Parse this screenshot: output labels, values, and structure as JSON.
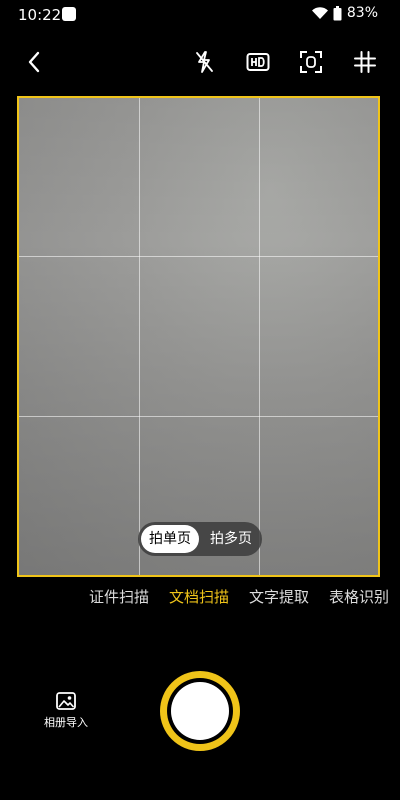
{
  "status_bar": {
    "time": "10:22",
    "battery": "83%"
  },
  "top_bar": {
    "icons": [
      "back-icon",
      "flash-off-icon",
      "hd-icon",
      "focus-icon",
      "grid-icon"
    ]
  },
  "capture_mode": {
    "single_label": "拍单页",
    "multi_label": "拍多页",
    "selected": "拍单页"
  },
  "scan_tabs": [
    {
      "label": "证件扫描",
      "active": false
    },
    {
      "label": "文档扫描",
      "active": true
    },
    {
      "label": "文字提取",
      "active": false
    },
    {
      "label": "表格识别",
      "active": false
    }
  ],
  "bottom": {
    "album_label": "相册导入"
  },
  "colors": {
    "accent": "#f0c419",
    "background": "#000000"
  }
}
